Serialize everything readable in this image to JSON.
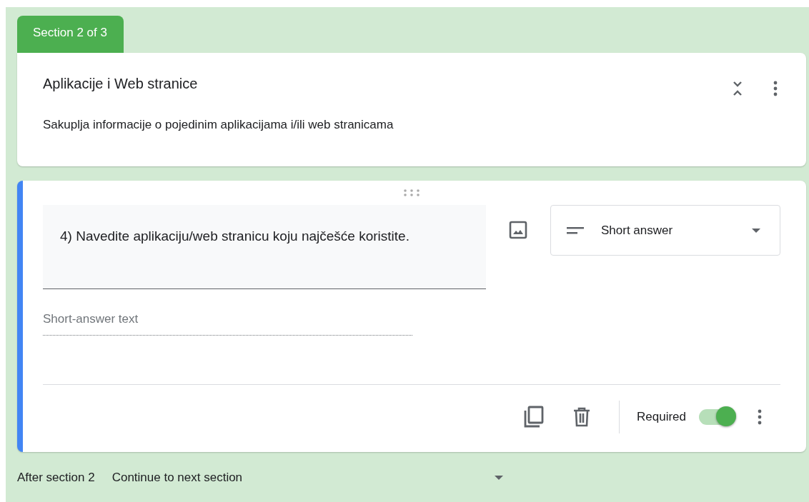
{
  "section_tab": "Section 2 of 3",
  "section": {
    "title": "Aplikacije i Web stranice",
    "description": "Sakuplja informacije o pojedinim aplikacijama  i/ili web stranicama"
  },
  "question": {
    "title": "4) Navedite aplikaciju/web stranicu koju najčešće koristite.",
    "type": "Short answer",
    "answer_placeholder": "Short-answer text",
    "required_label": "Required",
    "required": true
  },
  "after_section": {
    "label": "After section 2",
    "value": "Continue to next section"
  }
}
